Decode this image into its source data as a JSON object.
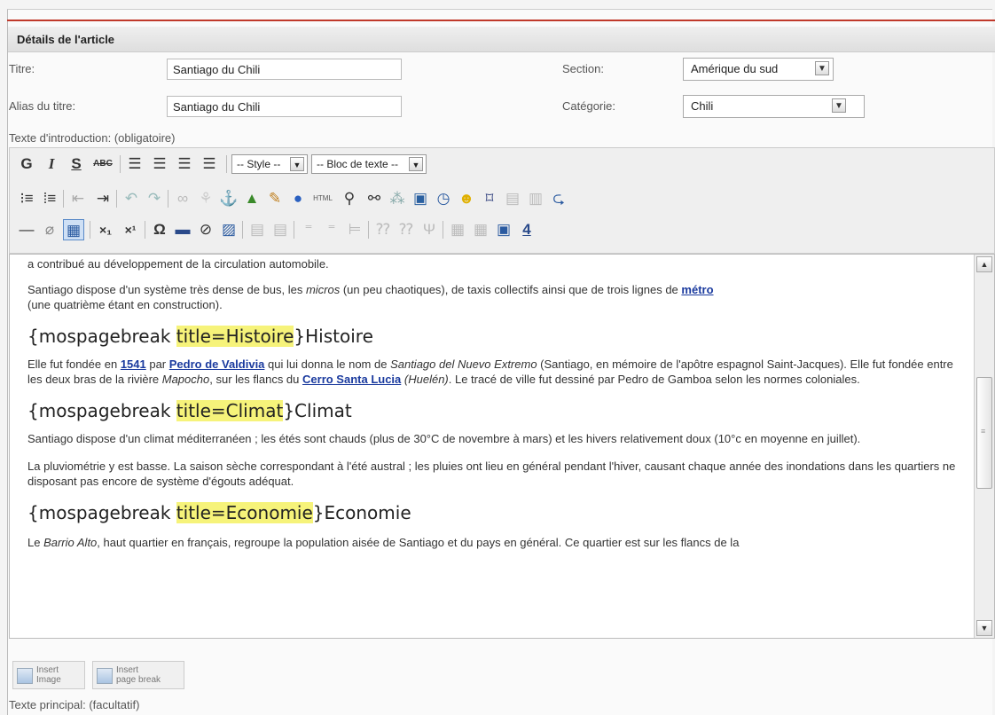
{
  "panel": {
    "title": "Détails de l'article"
  },
  "form": {
    "title_label": "Titre:",
    "title_value": "Santiago du Chili",
    "alias_label": "Alias du titre:",
    "alias_value": "Santiago du Chili",
    "section_label": "Section:",
    "section_value": "Amérique du sud",
    "category_label": "Catégorie:",
    "category_value": "Chili",
    "intro_label": "Texte d'introduction: (obligatoire)",
    "main_label": "Texte principal: (facultatif)"
  },
  "toolbar": {
    "style_select": "-- Style --",
    "block_select": "-- Bloc de texte --",
    "row1_icons": [
      "bold-icon",
      "italic-icon",
      "underline-icon",
      "strikethrough-icon",
      "align-left-icon",
      "align-center-icon",
      "align-right-icon",
      "align-justify-icon"
    ],
    "row2_icons": [
      "bullet-list-icon",
      "numbered-list-icon",
      "outdent-icon",
      "indent-icon",
      "undo-icon",
      "redo-icon",
      "link-icon",
      "unlink-icon",
      "anchor-icon",
      "image-icon",
      "cleanup-icon",
      "help-icon",
      "html-icon",
      "search-icon",
      "replace-icon",
      "insert-date-icon",
      "insert-time-icon",
      "clock-icon",
      "emoticon-icon",
      "fullscreen-icon",
      "copy-icon",
      "paste-icon",
      "paste-text-icon"
    ],
    "row3_icons": [
      "horizontal-rule-icon",
      "remove-format-icon",
      "visual-aid-icon",
      "subscript-icon",
      "superscript-icon",
      "special-char-icon",
      "media-icon",
      "no-style-icon",
      "edit-icon",
      "table-icon",
      "row-props-icon",
      "insert-row-icon",
      "delete-row-icon",
      "merge-cells-icon",
      "split-cells-icon",
      "column-icon",
      "layer-icon",
      "frame-icon",
      "spellcheck-icon"
    ],
    "glyphs": {
      "bold": "G",
      "italic": "I",
      "underline": "S",
      "strike": "ABC",
      "subscript": "×₁",
      "superscript": "×¹",
      "omega": "Ω"
    }
  },
  "content": {
    "p0": "a contribué au développement de la circulation automobile.",
    "p1_a": "Santiago dispose d'un système très dense de bus, les ",
    "p1_em": "micros",
    "p1_b": " (un peu chaotiques), de taxis collectifs ainsi que de trois lignes de ",
    "p1_link": "métro",
    "p1_c": "(une quatrième étant en construction).",
    "h1_pre": "{mospagebreak ",
    "h1_hl": "title=Histoire",
    "h1_post": "}Histoire",
    "p2_a": "Elle fut fondée en ",
    "p2_link1": "1541",
    "p2_b": " par ",
    "p2_link2": "Pedro de Valdivia",
    "p2_c": " qui lui donna le nom de ",
    "p2_em1": "Santiago del Nuevo Extremo",
    "p2_d": " (Santiago, en mémoire de l'apôtre espagnol Saint-Jacques). Elle fut fondée entre les deux bras de la rivière ",
    "p2_em2": "Mapocho",
    "p2_e": ", sur les flancs du ",
    "p2_link3": "Cerro Santa Lucia",
    "p2_em3": "(Huelén)",
    "p2_f": ". Le tracé de ville fut dessiné par Pedro de Gamboa selon les normes coloniales.",
    "h2_pre": "{mospagebreak ",
    "h2_hl": "title=Climat",
    "h2_post": "}Climat",
    "p3": "Santiago dispose d'un climat méditerranéen ; les étés sont chauds (plus de 30°C de novembre à mars) et les hivers relativement doux (10°c en moyenne en juillet).",
    "p4": "La pluviométrie y est basse. La saison sèche correspondant à l'été austral ; les pluies ont lieu en général pendant l'hiver, causant chaque année des inondations dans les quartiers ne disposant pas encore de système d'égouts adéquat.",
    "h3_pre": "{mospagebreak ",
    "h3_hl": "title=Economie",
    "h3_post": "}Economie",
    "p5_a": "Le ",
    "p5_em": "Barrio Alto",
    "p5_b": ", haut quartier en français, regroupe la population aisée de Santiago et du pays en général. Ce quartier est sur les flancs de la"
  },
  "buttons": {
    "insert_image": "Insert\nImage",
    "insert_image_l1": "Insert",
    "insert_image_l2": "Image",
    "insert_pb_l1": "Insert",
    "insert_pb_l2": "page break"
  }
}
